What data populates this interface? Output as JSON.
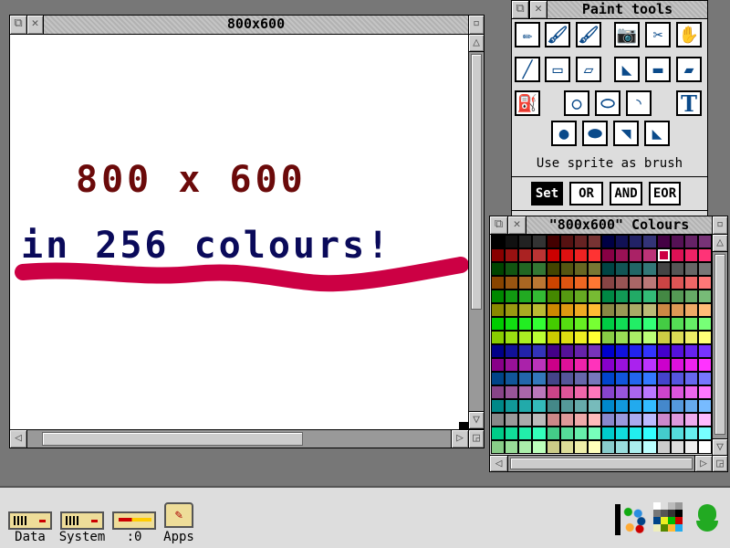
{
  "main_window": {
    "title": "800x600",
    "canvas": {
      "line1": "800 x 600",
      "line2": "in 256 colours!",
      "line1_color": "#6b0a0a",
      "line2_color": "#0a0a5a",
      "stroke_color": "#cc0044"
    }
  },
  "paint_tools": {
    "title": "Paint tools",
    "tools": [
      "pencil",
      "spray-can",
      "brush",
      "camera",
      "scissors",
      "hand",
      "line",
      "rectangle-outline",
      "parallelogram-outline",
      "triangle-fill",
      "rectangle-fill",
      "parallelogram-fill",
      "flood-fill",
      "circle-outline",
      "ellipse-outline",
      "arc",
      "text",
      "circle-fill",
      "ellipse-fill",
      "segment",
      "sector"
    ],
    "sprite_brush_label": "Use sprite as brush",
    "modes": [
      "Set",
      "OR",
      "AND",
      "EOR"
    ],
    "selected_mode": "Set"
  },
  "colours_window": {
    "title": "\"800x600\" Colours",
    "palette": "RISC OS 256-colour",
    "selected_colour_index": 28
  },
  "icon_bar": {
    "items": [
      {
        "label": "Data"
      },
      {
        "label": "System"
      },
      {
        "label": ":0"
      },
      {
        "label": "Apps"
      }
    ],
    "right": [
      "paint-icon",
      "display-manager-icon",
      "acorn-icon"
    ]
  }
}
